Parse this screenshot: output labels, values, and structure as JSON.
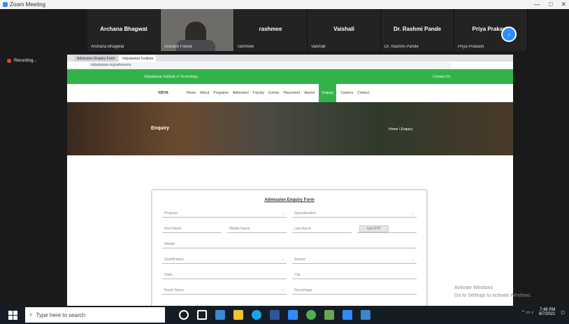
{
  "window": {
    "title": "Zoom Meeting"
  },
  "gallery": [
    {
      "name": "Archana Bhagwat",
      "sub": "Archana Bhagwat",
      "video": false
    },
    {
      "name": "",
      "sub": "Avinash Pawar",
      "video": true
    },
    {
      "name": "rashmee",
      "sub": "rashmee",
      "video": false
    },
    {
      "name": "Vaishali",
      "sub": "Vaishali",
      "video": false
    },
    {
      "name": "Dr. Rashmi Pande",
      "sub": "Dr. Rashmi Pande",
      "video": false
    },
    {
      "name": "Priya Prakash",
      "sub": "Priya Prakash",
      "video": false
    }
  ],
  "recording": {
    "label": "Recording..."
  },
  "browser": {
    "tabs": [
      "Admission Enquiry Form",
      "Vidyalankar Institute"
    ],
    "url": "vidyalankar.org/admission"
  },
  "site": {
    "greenbar_left": "Vidyalankar Institute of Technology",
    "greenbar_right": "Contact Us",
    "logo": "VIDYA",
    "nav": [
      "Home",
      "About",
      "Programs",
      "Admission",
      "Faculty",
      "Events",
      "Placement",
      "Alumni",
      "Careers",
      "Contact"
    ],
    "nav_active": "Enquiry",
    "hero_title": "Enquiry",
    "hero_crumb": "Home / Enquiry",
    "form_title": "Admission Enquiry Form",
    "fields": [
      [
        "Program",
        "Specialization"
      ],
      [
        "First Name",
        "Middle Name",
        "Last Name",
        "Get OTP"
      ],
      [
        "Mobile",
        ""
      ],
      [
        "Qualification",
        "Stream"
      ],
      [
        "State",
        "City"
      ],
      [
        "Board Name",
        "Percentage"
      ]
    ]
  },
  "watermark": {
    "line1": "Activate Windows",
    "line2": "Go to Settings to activate Windows."
  },
  "taskbar": {
    "search_placeholder": "Type here to search",
    "time": "7:48 PM",
    "date": "8/7/2021"
  }
}
